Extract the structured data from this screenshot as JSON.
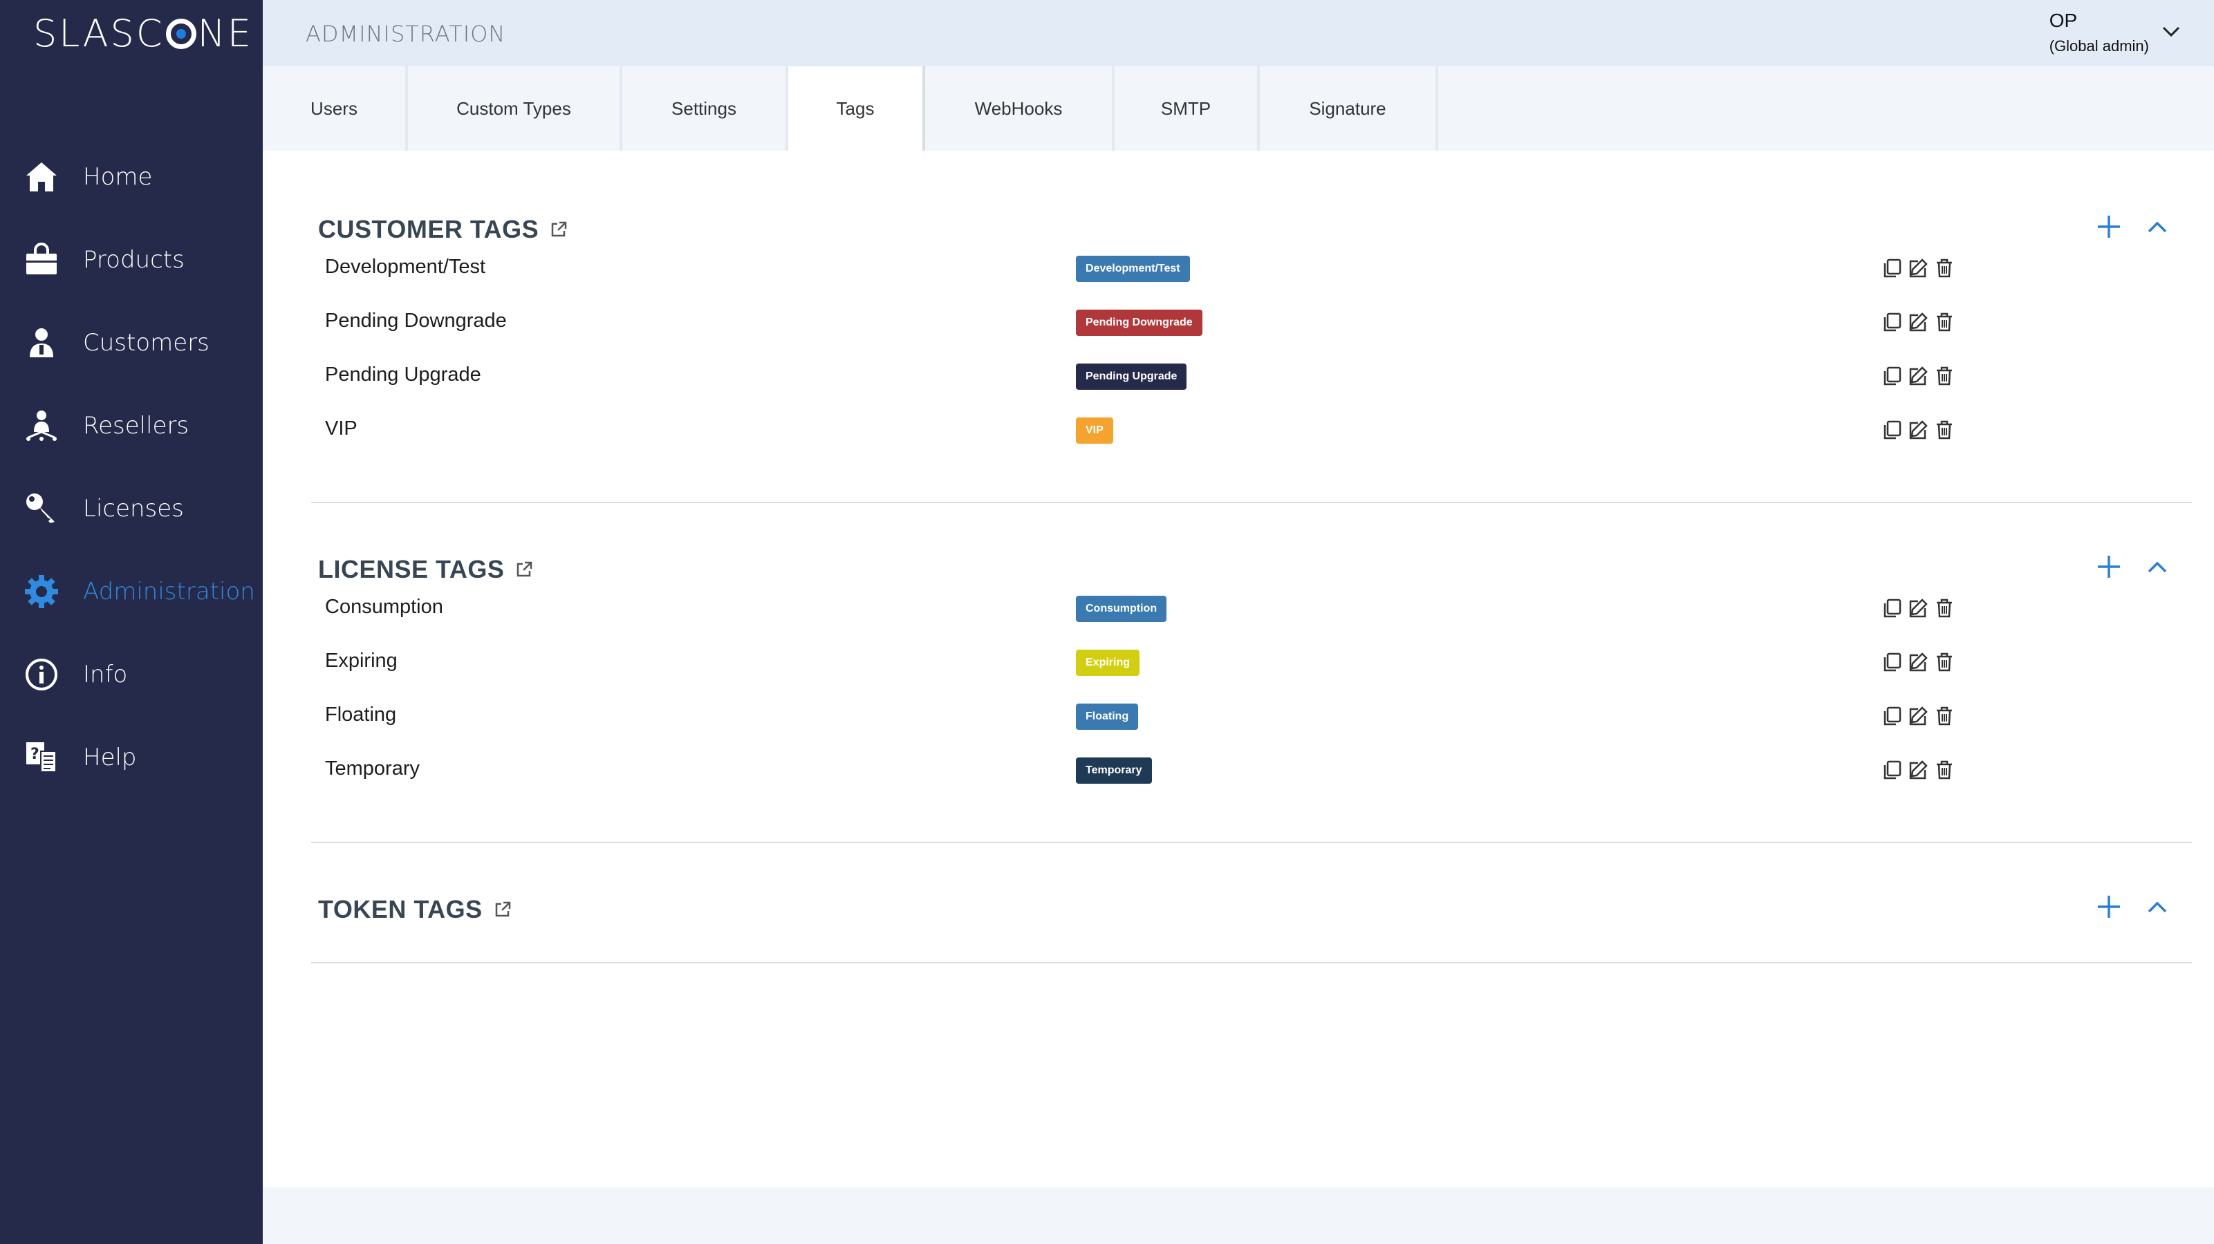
{
  "app": {
    "logo_text_left": "SLASC",
    "logo_text_right": "NE"
  },
  "header": {
    "title": "ADMINISTRATION"
  },
  "user": {
    "name": "OP",
    "role": "(Global admin)"
  },
  "sidebar": {
    "items": [
      {
        "label": "Home",
        "icon": "home-icon"
      },
      {
        "label": "Products",
        "icon": "shopping-bag-icon"
      },
      {
        "label": "Customers",
        "icon": "customer-icon"
      },
      {
        "label": "Resellers",
        "icon": "reseller-icon"
      },
      {
        "label": "Licenses",
        "icon": "key-icon"
      },
      {
        "label": "Administration",
        "icon": "gear-icon",
        "active": true
      },
      {
        "label": "Info",
        "icon": "info-icon"
      },
      {
        "label": "Help",
        "icon": "help-icon"
      }
    ]
  },
  "tabs": [
    {
      "label": "Users"
    },
    {
      "label": "Custom Types"
    },
    {
      "label": "Settings"
    },
    {
      "label": "Tags",
      "active": true
    },
    {
      "label": "WebHooks"
    },
    {
      "label": "SMTP"
    },
    {
      "label": "Signature"
    }
  ],
  "sections": [
    {
      "title": "CUSTOMER TAGS",
      "rows": [
        {
          "name": "Development/Test",
          "tag": "Development/Test",
          "color": "#3a7ab0"
        },
        {
          "name": "Pending Downgrade",
          "tag": "Pending Downgrade",
          "color": "#b0373a"
        },
        {
          "name": "Pending Upgrade",
          "tag": "Pending Upgrade",
          "color": "#262a4a"
        },
        {
          "name": "VIP",
          "tag": "VIP",
          "color": "#f5a32f"
        }
      ]
    },
    {
      "title": "LICENSE TAGS",
      "rows": [
        {
          "name": "Consumption",
          "tag": "Consumption",
          "color": "#3a7ab0"
        },
        {
          "name": "Expiring",
          "tag": "Expiring",
          "color": "#d2cf12"
        },
        {
          "name": "Floating",
          "tag": "Floating",
          "color": "#3a7ab0"
        },
        {
          "name": "Temporary",
          "tag": "Temporary",
          "color": "#1f3a54"
        }
      ]
    },
    {
      "title": "TOKEN TAGS",
      "rows": []
    }
  ],
  "colors": {
    "sidebar_bg": "#262a4a",
    "accent": "#2f8ae0",
    "header_bg": "#e2ebf6"
  }
}
